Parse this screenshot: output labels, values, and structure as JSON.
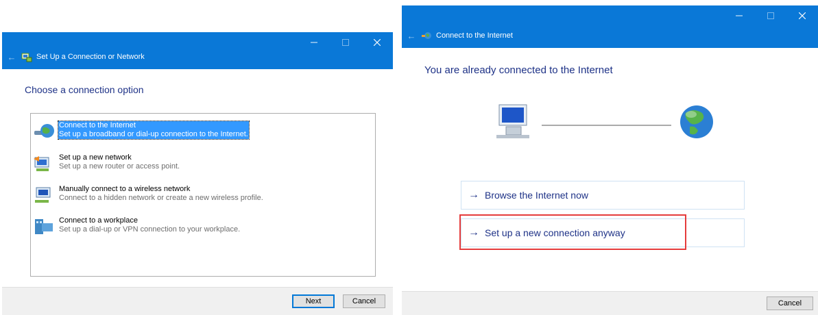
{
  "left_window": {
    "title": "Set Up a Connection or Network",
    "heading": "Choose a connection option",
    "options": [
      {
        "title": "Connect to the Internet",
        "description": "Set up a broadband or dial-up connection to the Internet."
      },
      {
        "title": "Set up a new network",
        "description": "Set up a new router or access point."
      },
      {
        "title": "Manually connect to a wireless network",
        "description": "Connect to a hidden network or create a new wireless profile."
      },
      {
        "title": "Connect to a workplace",
        "description": "Set up a dial-up or VPN connection to your workplace."
      }
    ],
    "selected_index": 0,
    "buttons": {
      "next": "Next",
      "cancel": "Cancel"
    }
  },
  "right_window": {
    "title": "Connect to the Internet",
    "heading": "You are already connected to the Internet",
    "links": [
      {
        "arrow": "→",
        "label": "Browse the Internet now"
      },
      {
        "arrow": "→",
        "label": "Set up a new connection anyway"
      }
    ],
    "highlighted_link_index": 1,
    "buttons": {
      "cancel": "Cancel"
    }
  },
  "caption_icons": [
    "minimize-icon",
    "maximize-icon",
    "close-icon"
  ],
  "colors": {
    "titlebar": "#0a78d7",
    "heading_text": "#1e3287",
    "selection": "#3399ff",
    "highlight_box": "#e53b3b",
    "footer": "#f0f0f0"
  }
}
